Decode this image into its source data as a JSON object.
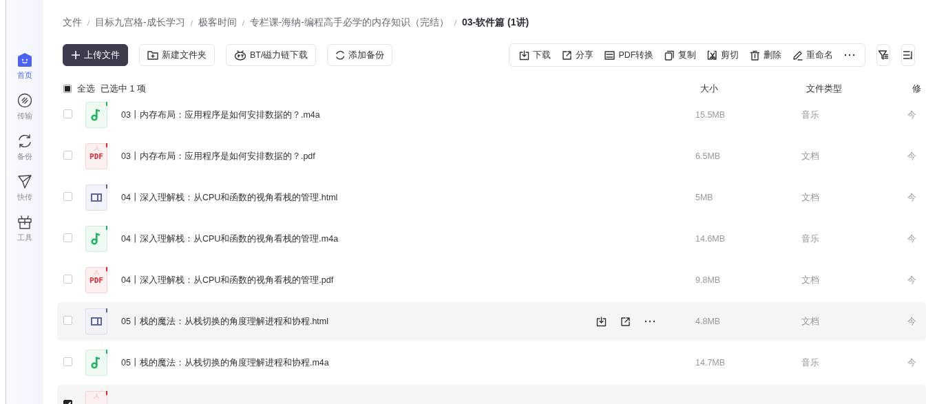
{
  "sidebar": {
    "items": [
      {
        "kind": "home",
        "label": "首页",
        "selected": true
      },
      {
        "kind": "transfer",
        "label": "传输",
        "selected": false
      },
      {
        "kind": "backup",
        "label": "备份",
        "selected": false
      },
      {
        "kind": "send",
        "label": "快传",
        "selected": false
      },
      {
        "kind": "tools",
        "label": "工具",
        "selected": false
      }
    ]
  },
  "breadcrumb": [
    "文件",
    "目标九宫格-成长学习",
    "极客时间",
    "专栏课-海纳-编程高手必学的内存知识（完结）",
    "03-软件篇 (1讲)"
  ],
  "toolbar": {
    "buttons": [
      {
        "kind": "upload",
        "label": "上传文件"
      },
      {
        "kind": "folder",
        "label": "新建文件夹"
      },
      {
        "kind": "bt",
        "label": "BT/磁力链下载"
      },
      {
        "kind": "backup",
        "label": "添加备份"
      }
    ],
    "actions": [
      {
        "kind": "download",
        "label": "下载"
      },
      {
        "kind": "share",
        "label": "分享"
      },
      {
        "kind": "pdf",
        "label": "PDF转换"
      },
      {
        "kind": "copy",
        "label": "复制"
      },
      {
        "kind": "cut",
        "label": "剪切"
      },
      {
        "kind": "delete",
        "label": "删除"
      },
      {
        "kind": "rename",
        "label": "重命名"
      },
      {
        "kind": "more"
      }
    ],
    "tools": [
      {
        "kind": "filter"
      },
      {
        "kind": "sort"
      }
    ]
  },
  "table": {
    "select_all": {
      "label": "全选",
      "checked": false,
      "partial": true
    },
    "selection_count": "已选中 1 项",
    "columns": [
      "大小",
      "文件类型",
      "修"
    ],
    "rows": [
      {
        "kind": "audio",
        "name": "03丨内存布局：应用程序是如何安排数据的？.m4a",
        "size": "15.5MB",
        "file_type": "音乐",
        "modified": "今",
        "checked": false,
        "hovered": false
      },
      {
        "kind": "pdf",
        "icon_label": "PDF",
        "name": "03丨内存布局：应用程序是如何安排数据的？.pdf",
        "size": "6.5MB",
        "file_type": "文档",
        "modified": "今",
        "checked": false,
        "hovered": false
      },
      {
        "kind": "html",
        "name": "04丨深入理解栈：从CPU和函数的视角看栈的管理.html",
        "size": "5MB",
        "file_type": "文档",
        "modified": "今",
        "checked": false,
        "hovered": false
      },
      {
        "kind": "audio",
        "name": "04丨深入理解栈：从CPU和函数的视角看栈的管理.m4a",
        "size": "14.6MB",
        "file_type": "音乐",
        "modified": "今",
        "checked": false,
        "hovered": false
      },
      {
        "kind": "pdf",
        "icon_label": "PDF",
        "name": "04丨深入理解栈：从CPU和函数的视角看栈的管理.pdf",
        "size": "9.8MB",
        "file_type": "文档",
        "modified": "今",
        "checked": false,
        "hovered": false
      },
      {
        "kind": "html",
        "name": "05丨栈的魔法：从栈切换的角度理解进程和协程.html",
        "size": "4.8MB",
        "file_type": "文档",
        "modified": "今",
        "checked": false,
        "hovered": true
      },
      {
        "kind": "audio",
        "name": "05丨栈的魔法：从栈切换的角度理解进程和协程.m4a",
        "size": "14.7MB",
        "file_type": "音乐",
        "modified": "今",
        "checked": false,
        "hovered": false
      },
      {
        "kind": "pdf",
        "checked": true,
        "hovered": false
      }
    ]
  }
}
